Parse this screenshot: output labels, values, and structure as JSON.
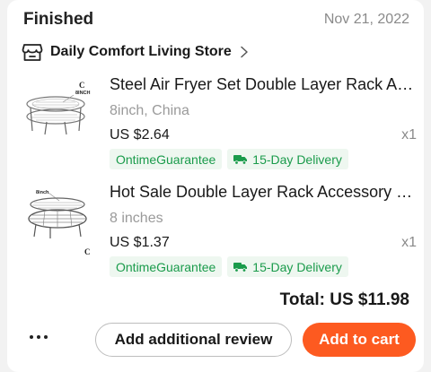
{
  "order": {
    "status": "Finished",
    "date": "Nov 21, 2022",
    "store_name": "Daily Comfort Living Store",
    "total": "Total: US $11.98"
  },
  "items": [
    {
      "title": "Steel Air Fryer Set Double Layer Rack Accessory",
      "variant": "8inch, China",
      "price": "US $2.64",
      "quantity": "x1",
      "image_text": "8INCH",
      "image_letter": "C",
      "tags": [
        "OntimeGuarantee",
        "15-Day Delivery"
      ]
    },
    {
      "title": "Hot Sale Double Layer Rack Accessory for Air Fryer",
      "variant": "8 inches",
      "price": "US $1.37",
      "quantity": "x1",
      "image_text": "8inch",
      "image_letter": "C",
      "tags": [
        "OntimeGuarantee",
        "15-Day Delivery"
      ]
    }
  ],
  "actions": {
    "review_label": "Add additional review",
    "cart_label": "Add to cart"
  },
  "colors": {
    "accent": "#fd5a20",
    "tag_green": "#1a9b4b",
    "tag_bg": "#eef7f0"
  },
  "icons": {
    "store": "store-icon",
    "chevron": "chevron-right-icon",
    "truck": "truck-icon",
    "more": "more-dots-icon"
  }
}
